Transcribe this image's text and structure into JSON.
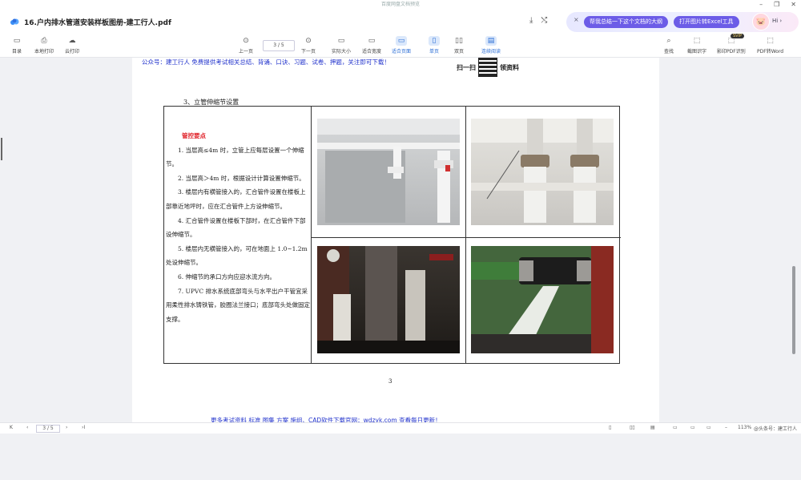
{
  "window": {
    "title": "百度网盘文档预览",
    "min": "–",
    "restore": "❐",
    "close": "✕"
  },
  "file": {
    "name": "16.户内排水管道安装样板图册-建工行人.pdf"
  },
  "ai": {
    "close": "×",
    "btn1": "帮我总结一下这个文档的大纲",
    "btn2": "打开图片转Excel工具",
    "hi": "Hi ›"
  },
  "toolbar": {
    "left": [
      {
        "icon": "▭",
        "label": "目录"
      },
      {
        "icon": "⎙",
        "label": "本地打印"
      },
      {
        "icon": "☁",
        "label": "云打印"
      }
    ],
    "center": [
      {
        "icon": "⊙",
        "label": "上一页",
        "active": false
      },
      {
        "icon": "⊙",
        "label": "下一页",
        "active": false
      },
      {
        "icon": "▭",
        "label": "实际大小",
        "active": false
      },
      {
        "icon": "▭",
        "label": "适合宽度",
        "active": false
      },
      {
        "icon": "▭",
        "label": "适合页面",
        "active": true
      },
      {
        "icon": "▯",
        "label": "单页",
        "active": true
      },
      {
        "icon": "▯▯",
        "label": "双页",
        "active": false
      },
      {
        "icon": "▤",
        "label": "连续阅读",
        "active": true
      }
    ],
    "page_input": "3 / 5",
    "right": [
      {
        "icon": "⌕",
        "label": "查找"
      },
      {
        "icon": "⬚",
        "label": "截图识字"
      },
      {
        "icon": "⬚",
        "label": "影印PDF识别"
      },
      {
        "icon": "⬚",
        "label": "PDF转Word"
      }
    ],
    "svip": "SVIP"
  },
  "document": {
    "watermark_top": "公众号：建工行人 免费提供考试相关总结、背诵、口诀、习题、试卷、押题，关注即可下载！",
    "qr_left": "扫一扫",
    "qr_right": "领资料",
    "section_title": "3、立管伸缩节设置",
    "key_title": "管控要点",
    "paragraphs": [
      "1. 当层高≤4m 时，立管上应每层设置一个伸缩节。",
      "2. 当层高＞4m 时，根据设计计算设置伸缩节。",
      "3. 楼层内有横管接入的，汇合管件设置在楼板上部靠近地坪时，应在汇合管件上方设伸缩节。",
      "4. 汇合管件设置在楼板下部时，在汇合管件下部设伸缩节。",
      "5. 楼层内无横管接入的，可在地面上 1.0~1.2m 处设伸缩节。",
      "6. 伸缩节的承口方向应迎水流方向。",
      "7. UPVC 排水系统底部弯头与水平出户干管宜采用柔性排水铸铁管，胶圈法兰接口；底部弯头处做固定支撑。"
    ],
    "page_number": "3",
    "watermark_bottom": "更多考试资料 标准 图集 方案 施组、CAD软件下载官网：wdzyk.com 查看每日更新！"
  },
  "status": {
    "first": "K",
    "prev": "‹",
    "page": "3 / 5",
    "next": "›",
    "last": "›I",
    "zoom_minus": "–",
    "zoom": "113%",
    "zoom_plus": "+",
    "brand": "@头条号：建工行人"
  }
}
